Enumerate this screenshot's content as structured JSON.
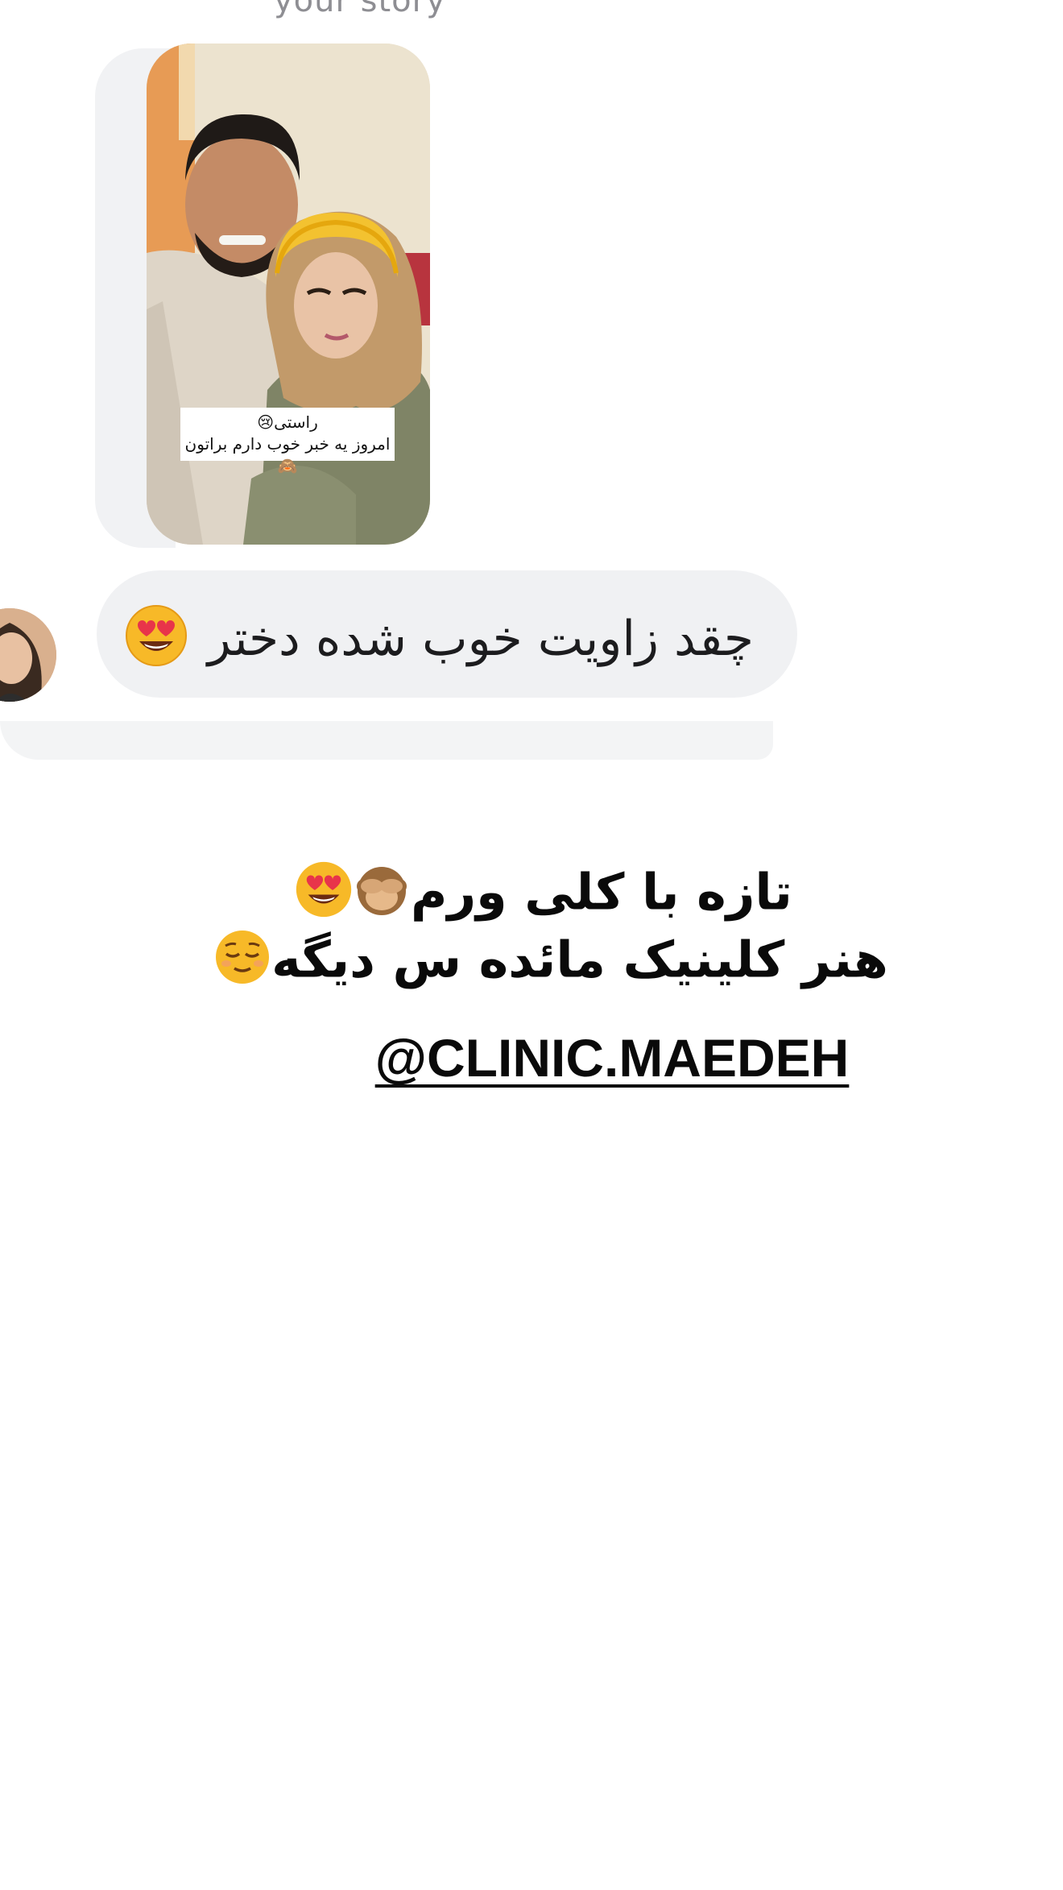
{
  "header": {
    "text": "your story"
  },
  "story": {
    "caption_line1": "راستی😢",
    "caption_line2": "امروز یه خبر خوب دارم براتون🙈"
  },
  "message": {
    "text": "چقد زاویت خوب شده دختر",
    "emoji": "heart-eyes-emoji"
  },
  "promo": {
    "line1": "تازه با کلی ورم",
    "line1_emojis": [
      "see-no-evil-monkey-emoji",
      "heart-eyes-emoji"
    ],
    "line2": "هنر کلینیک مائده س دیگه",
    "line2_emoji": "relieved-face-emoji",
    "handle": "@CLINIC.MAEDEH"
  }
}
